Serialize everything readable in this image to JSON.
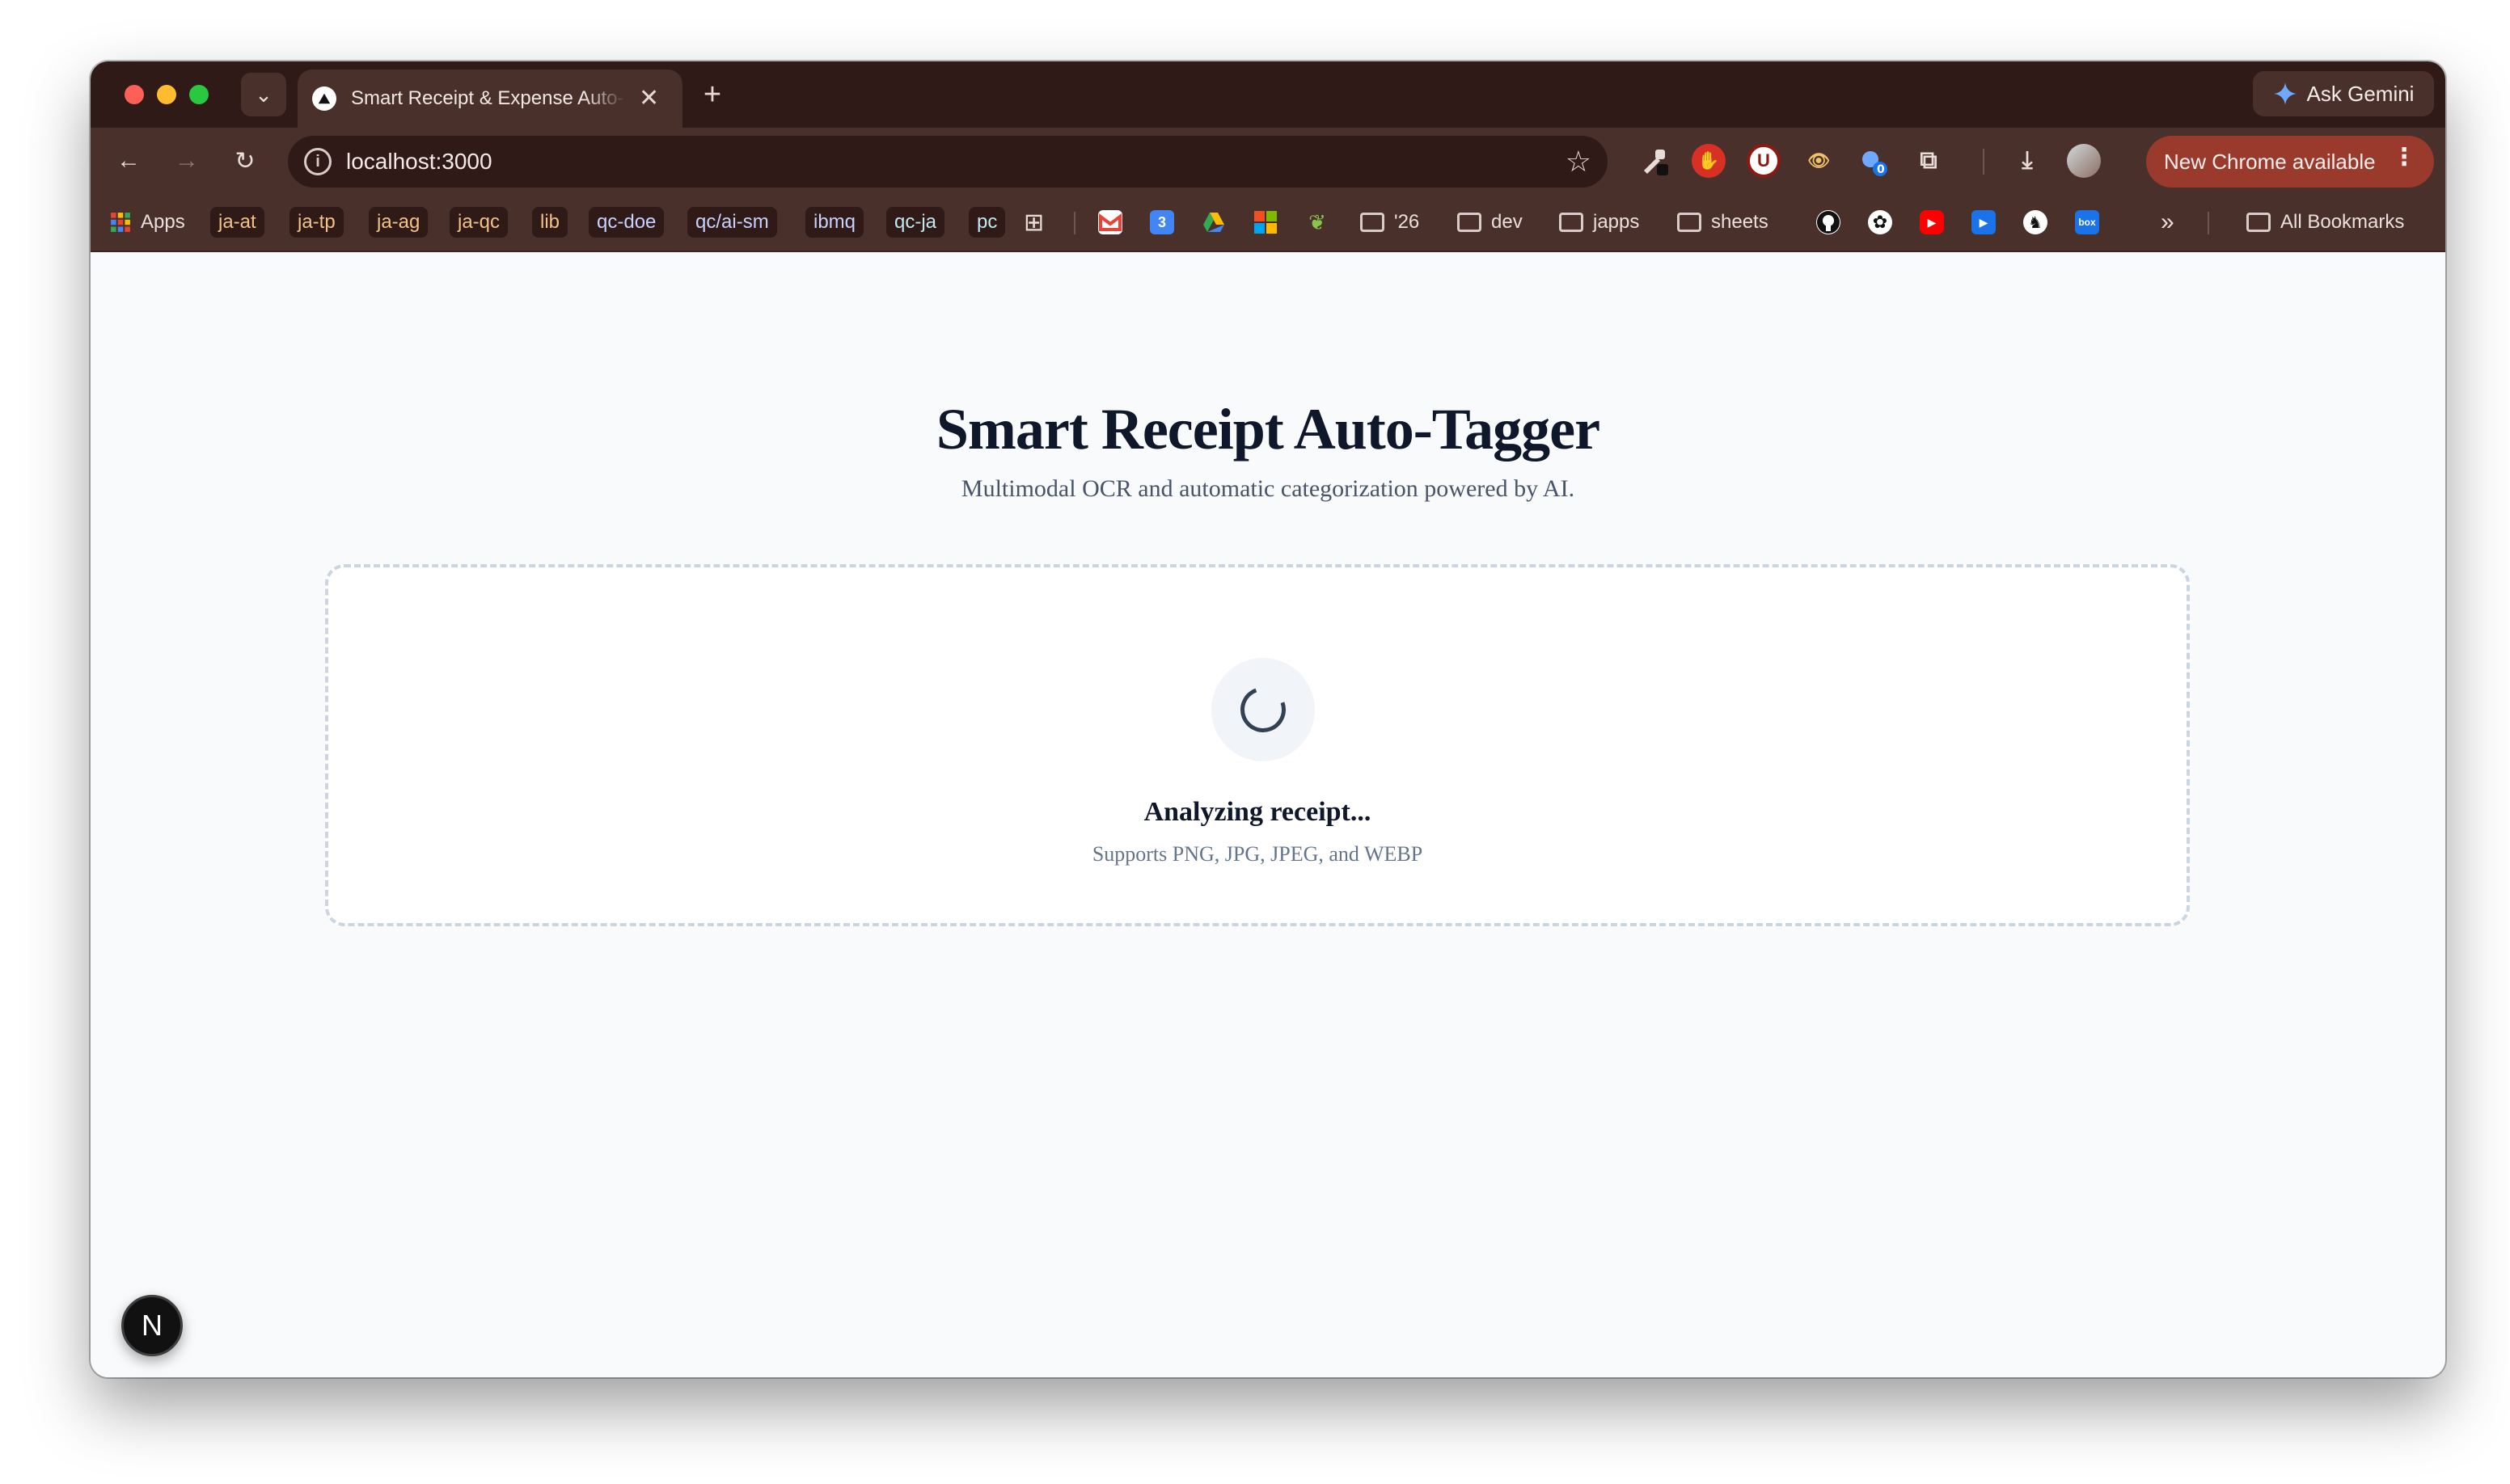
{
  "browser": {
    "tab": {
      "title": "Smart Receipt & Expense Auto-Tagger",
      "close_glyph": "✕"
    },
    "tab_search_glyph": "⌄",
    "new_tab_glyph": "+",
    "ask_gemini_label": "Ask Gemini",
    "nav": {
      "back": "←",
      "forward": "→",
      "reload": "↻"
    },
    "url": "localhost:3000",
    "bookmark_star": "☆",
    "update_button_label": "New Chrome available",
    "update_menu_glyph": "⋮",
    "extension_badge": "0",
    "bookmarks": {
      "apps_label": "Apps",
      "chips": [
        "ja-at",
        "ja-tp",
        "ja-ag",
        "ja-qc",
        "lib",
        "qc-doe",
        "qc/ai-sm",
        "ibmq",
        "qc-ja",
        "pc"
      ],
      "folders": [
        "'26",
        "dev",
        "japps",
        "sheets"
      ],
      "overflow": "»",
      "all_bookmarks_label": "All Bookmarks"
    }
  },
  "page": {
    "title": "Smart Receipt Auto-Tagger",
    "subtitle": "Multimodal OCR and automatic categorization powered by AI.",
    "upload": {
      "status": "Analyzing receipt...",
      "hint": "Supports PNG, JPG, JPEG, and WEBP"
    },
    "dev_badge": "N"
  },
  "colors": {
    "title_text": "#0f172a",
    "subtitle_text": "#475569",
    "hint_text": "#64748b",
    "dropzone_border": "#cbd5e1",
    "chrome_frame": "#4a302b",
    "update_button": "#9a3a2c"
  }
}
